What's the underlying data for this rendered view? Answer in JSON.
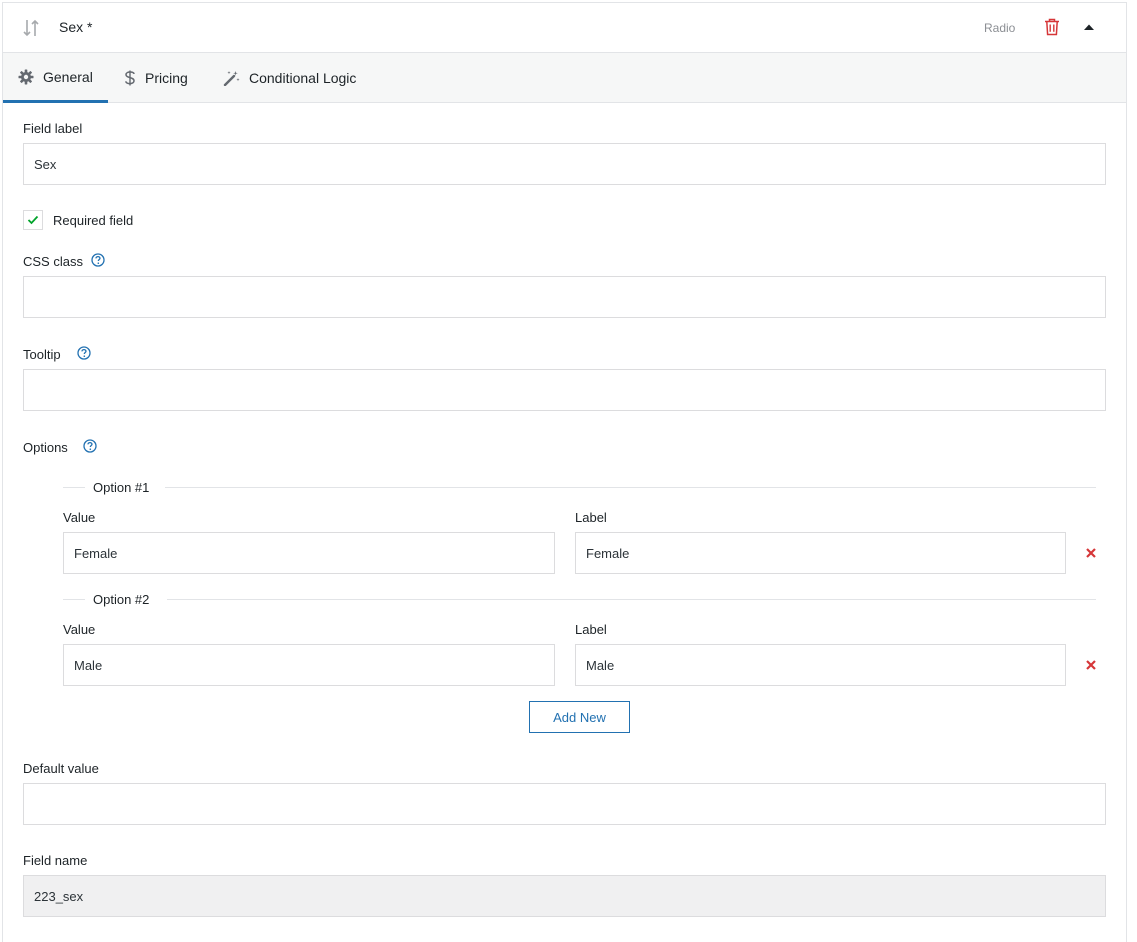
{
  "header": {
    "title": "Sex *",
    "field_type": "Radio",
    "drag_icon": "sort-arrows-icon",
    "delete_icon": "trash-icon",
    "collapse_icon": "caret-up-icon"
  },
  "tabs": [
    {
      "label": "General",
      "icon": "gear-icon",
      "active": true
    },
    {
      "label": "Pricing",
      "icon": "dollar-icon",
      "active": false
    },
    {
      "label": "Conditional Logic",
      "icon": "magic-wand-icon",
      "active": false
    }
  ],
  "colors": {
    "accent": "#2271b1",
    "danger": "#d63638",
    "check": "#00a32a"
  },
  "form": {
    "field_label": {
      "label": "Field label",
      "value": "Sex"
    },
    "required": {
      "label": "Required field",
      "checked": true
    },
    "css_class": {
      "label": "CSS class",
      "value": ""
    },
    "tooltip": {
      "label": "Tooltip",
      "value": ""
    },
    "options": {
      "label": "Options",
      "items": [
        {
          "legend": "Option #1",
          "value_label": "Value",
          "value": "Female",
          "label_label": "Label",
          "label": "Female"
        },
        {
          "legend": "Option #2",
          "value_label": "Value",
          "value": "Male",
          "label_label": "Label",
          "label": "Male"
        }
      ],
      "add_label": "Add New"
    },
    "default_value": {
      "label": "Default value",
      "value": ""
    },
    "field_name": {
      "label": "Field name",
      "value": "223_sex"
    }
  }
}
